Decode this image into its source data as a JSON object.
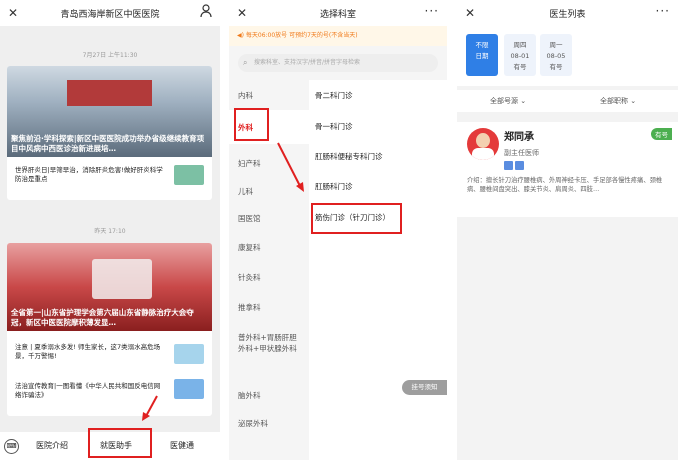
{
  "left_panel": {
    "title": "青岛西海岸新区中医医院",
    "timestamp1": "7月27日 上午11:30",
    "news1_caption": "聚焦前沿·学科探索|新区中医医院成功举办省级继续教育项目中风病中西医诊治新进展培…",
    "news1_item": "世界肝炎日|早筛早治，消除肝炎危害!做好肝炎科学防治是重点",
    "timestamp2": "昨天 17:10",
    "news2_caption": "全省第一|山东省护理学会第六届山东省静脉治疗大会夺冠，新区中医医院摩积薄发显…",
    "news2_item1": "注意 | 夏季溺水多发! 师生家长，这7类溺水高危场景，千万警惕!",
    "news2_item2": "法治宣传教育|一图看懂《中华人民共和国反电信网络诈骗法》",
    "bottom_tabs": [
      "医院介绍",
      "就医助手",
      "医健通"
    ],
    "keyboard_icon_text": "⌨"
  },
  "middle_panel": {
    "title": "选择科室",
    "notice": "每天06:00放号 可预约7天的号(不含当天)",
    "search_placeholder": "搜索科室、支持汉字/拼音/拼音字母检索",
    "departments": [
      "内科",
      "外科",
      "妇产科",
      "儿科",
      "国医馆",
      "康复科",
      "针灸科",
      "推拿科",
      "普外科+胃肠肝胆外科+甲状腺外科",
      "脑外科",
      "泌尿外科"
    ],
    "clinics": [
      "骨二科门诊",
      "骨一科门诊",
      "肛肠科便秘专科门诊",
      "肛肠科门诊",
      "筋伤门诊（针刀门诊）"
    ],
    "float_button": "挂号须知"
  },
  "right_panel": {
    "title": "医生列表",
    "dates": [
      {
        "line1": "不限",
        "line2": "日期",
        "line3": ""
      },
      {
        "line1": "周四",
        "line2": "08-01",
        "line3": "有号"
      },
      {
        "line1": "周一",
        "line2": "08-05",
        "line3": "有号"
      }
    ],
    "filter_source": "全部号源",
    "filter_title": "全部职称",
    "doctor": {
      "name": "郑同承",
      "title": "副主任医师",
      "badge": "有号",
      "intro": "介绍：擅长针刀治疗腰椎病、外周神经卡压、手足部各慢性疼痛、颈椎病、腰椎间盘突出、膝关节炎、肩周炎、四肢…"
    }
  },
  "colors": {
    "accent_blue": "#2f7fe6",
    "accent_red": "#e02020",
    "orange": "#f07a1a",
    "green_badge": "#4caf50"
  }
}
